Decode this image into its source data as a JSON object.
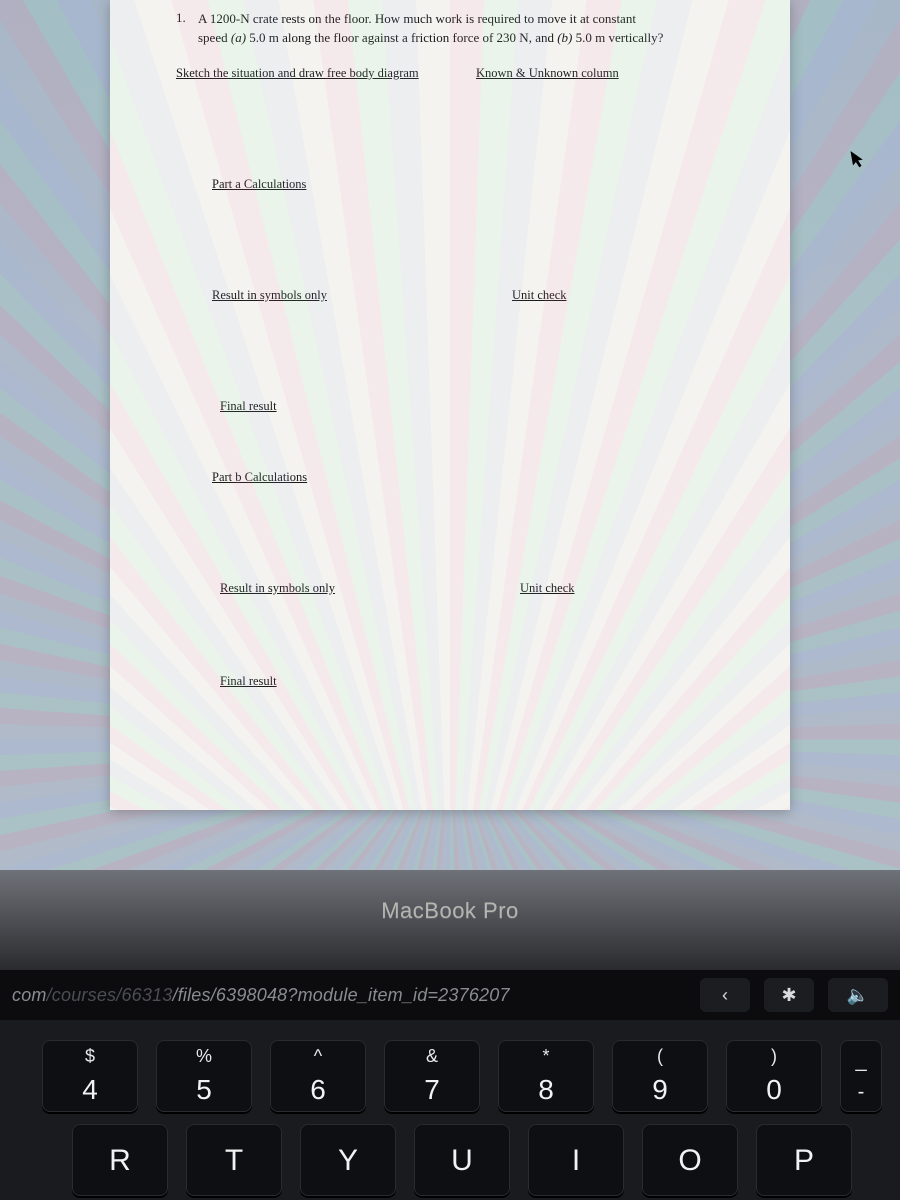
{
  "question": {
    "number": "1.",
    "line1_a": "A 1200-N crate rests on the floor. How much work is required to move it at constant",
    "line2_a": "speed ",
    "part_a_label": "(a)",
    "line2_b": " 5.0 m along the floor against a friction force of 230 N, and ",
    "part_b_label": "(b)",
    "line2_c": " 5.0 m vertically?"
  },
  "sections": {
    "sketch": "Sketch the situation and draw free body diagram",
    "known": "Known & Unknown column",
    "part_a_calc": "Part a Calculations",
    "result_symbols_a": "Result in symbols only",
    "unit_check_a": "Unit check",
    "final_result_a": "Final result",
    "part_b_calc": "Part b Calculations",
    "result_symbols_b": "Result in symbols only",
    "unit_check_b": "Unit check",
    "final_result_b": "Final result"
  },
  "bezel": {
    "label": "MacBook Pro"
  },
  "touchbar": {
    "url_dim1": "com",
    "url_dim2": "/courses/66313",
    "url_mid": "/files/6398048?module_item_id=2376207",
    "back_icon": "‹",
    "brightness_icon": "✱",
    "volume_icon": "🔈"
  },
  "keys_row1": [
    {
      "top": "$",
      "bot": "4"
    },
    {
      "top": "%",
      "bot": "5"
    },
    {
      "top": "^",
      "bot": "6"
    },
    {
      "top": "&",
      "bot": "7"
    },
    {
      "top": "*",
      "bot": "8"
    },
    {
      "top": "(",
      "bot": "9"
    },
    {
      "top": ")",
      "bot": "0"
    }
  ],
  "key_half": {
    "top": "_",
    "bot": "-"
  },
  "keys_row2": [
    {
      "bot": "R"
    },
    {
      "bot": "T"
    },
    {
      "bot": "Y"
    },
    {
      "bot": "U"
    },
    {
      "bot": "I"
    },
    {
      "bot": "O"
    },
    {
      "bot": "P"
    }
  ]
}
